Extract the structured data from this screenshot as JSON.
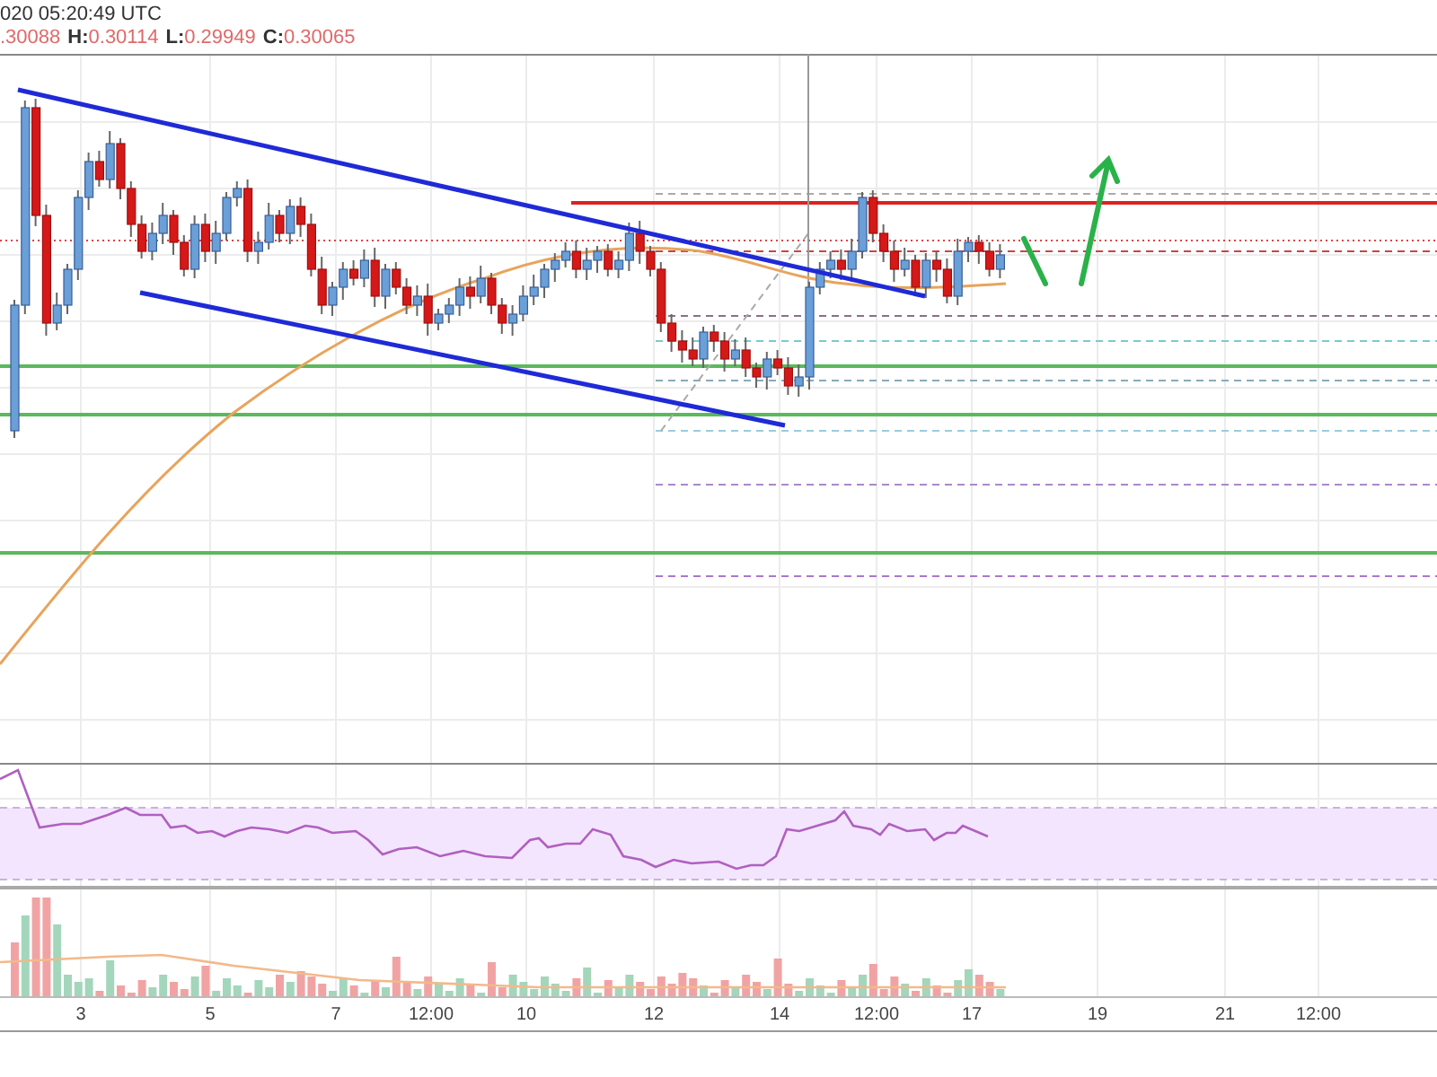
{
  "header": {
    "timestamp": "020 05:20:49 UTC",
    "ohlc": [
      {
        "value": ".30088"
      },
      {
        "label": "H:",
        "value": "0.30114"
      },
      {
        "label": "L:",
        "value": "0.29949"
      },
      {
        "label": "C:",
        "value": "0.30065"
      }
    ]
  },
  "x_axis": {
    "labels": [
      "3",
      "5",
      "7",
      "12:00",
      "10",
      "12",
      "14",
      "12:00",
      "17",
      "19",
      "21",
      "12:00"
    ]
  }
}
